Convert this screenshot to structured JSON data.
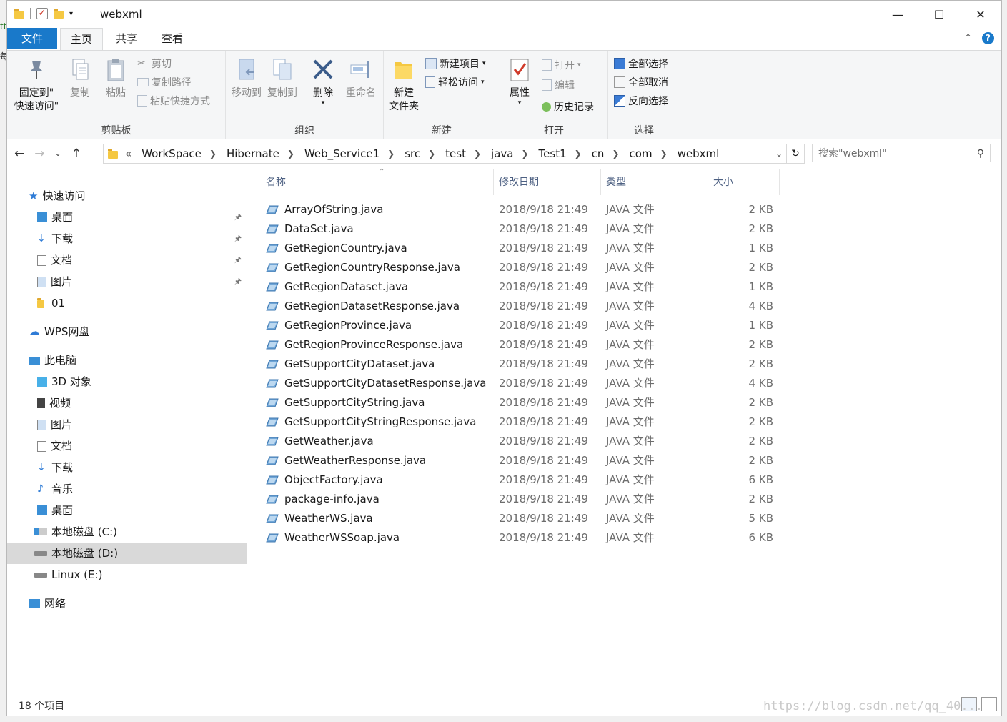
{
  "window": {
    "title": "webxml"
  },
  "tabs": [
    {
      "label": "文件"
    },
    {
      "label": "主页"
    },
    {
      "label": "共享"
    },
    {
      "label": "查看"
    }
  ],
  "ribbon": {
    "clipboard": {
      "label": "剪贴板",
      "pin_line1": "固定到\"",
      "pin_line2": "快速访问\"",
      "copy": "复制",
      "paste": "粘贴",
      "cut": "剪切",
      "copy_path": "复制路径",
      "paste_shortcut": "粘贴快捷方式"
    },
    "organize": {
      "label": "组织",
      "move_to": "移动到",
      "copy_to": "复制到",
      "delete": "删除",
      "rename": "重命名"
    },
    "new": {
      "label": "新建",
      "new_folder_line1": "新建",
      "new_folder_line2": "文件夹",
      "new_item": "新建项目",
      "easy_access": "轻松访问"
    },
    "open": {
      "label": "打开",
      "properties": "属性",
      "open": "打开",
      "edit": "编辑",
      "history": "历史记录"
    },
    "select": {
      "label": "选择",
      "select_all": "全部选择",
      "select_none": "全部取消",
      "invert": "反向选择"
    }
  },
  "address": {
    "crumbs": [
      "WorkSpace",
      "Hibernate",
      "Web_Service1",
      "src",
      "test",
      "java",
      "Test1",
      "cn",
      "com",
      "webxml"
    ]
  },
  "search": {
    "placeholder": "搜索\"webxml\""
  },
  "nav_pane": {
    "quick_access": "快速访问",
    "quick_items": [
      {
        "label": "桌面",
        "pinned": true
      },
      {
        "label": "下载",
        "pinned": true
      },
      {
        "label": "文档",
        "pinned": true
      },
      {
        "label": "图片",
        "pinned": true
      },
      {
        "label": "01",
        "pinned": false
      }
    ],
    "wps": "WPS网盘",
    "this_pc": "此电脑",
    "pc_items": [
      {
        "label": "3D 对象"
      },
      {
        "label": "视频"
      },
      {
        "label": "图片"
      },
      {
        "label": "文档"
      },
      {
        "label": "下载"
      },
      {
        "label": "音乐"
      },
      {
        "label": "桌面"
      },
      {
        "label": "本地磁盘 (C:)"
      },
      {
        "label": "本地磁盘 (D:)"
      },
      {
        "label": "Linux (E:)"
      }
    ],
    "network": "网络"
  },
  "columns": {
    "name": "名称",
    "date": "修改日期",
    "type": "类型",
    "size": "大小"
  },
  "files": [
    {
      "name": "ArrayOfString.java",
      "date": "2018/9/18 21:49",
      "type": "JAVA 文件",
      "size": "2 KB"
    },
    {
      "name": "DataSet.java",
      "date": "2018/9/18 21:49",
      "type": "JAVA 文件",
      "size": "2 KB"
    },
    {
      "name": "GetRegionCountry.java",
      "date": "2018/9/18 21:49",
      "type": "JAVA 文件",
      "size": "1 KB"
    },
    {
      "name": "GetRegionCountryResponse.java",
      "date": "2018/9/18 21:49",
      "type": "JAVA 文件",
      "size": "2 KB"
    },
    {
      "name": "GetRegionDataset.java",
      "date": "2018/9/18 21:49",
      "type": "JAVA 文件",
      "size": "1 KB"
    },
    {
      "name": "GetRegionDatasetResponse.java",
      "date": "2018/9/18 21:49",
      "type": "JAVA 文件",
      "size": "4 KB"
    },
    {
      "name": "GetRegionProvince.java",
      "date": "2018/9/18 21:49",
      "type": "JAVA 文件",
      "size": "1 KB"
    },
    {
      "name": "GetRegionProvinceResponse.java",
      "date": "2018/9/18 21:49",
      "type": "JAVA 文件",
      "size": "2 KB"
    },
    {
      "name": "GetSupportCityDataset.java",
      "date": "2018/9/18 21:49",
      "type": "JAVA 文件",
      "size": "2 KB"
    },
    {
      "name": "GetSupportCityDatasetResponse.java",
      "date": "2018/9/18 21:49",
      "type": "JAVA 文件",
      "size": "4 KB"
    },
    {
      "name": "GetSupportCityString.java",
      "date": "2018/9/18 21:49",
      "type": "JAVA 文件",
      "size": "2 KB"
    },
    {
      "name": "GetSupportCityStringResponse.java",
      "date": "2018/9/18 21:49",
      "type": "JAVA 文件",
      "size": "2 KB"
    },
    {
      "name": "GetWeather.java",
      "date": "2018/9/18 21:49",
      "type": "JAVA 文件",
      "size": "2 KB"
    },
    {
      "name": "GetWeatherResponse.java",
      "date": "2018/9/18 21:49",
      "type": "JAVA 文件",
      "size": "2 KB"
    },
    {
      "name": "ObjectFactory.java",
      "date": "2018/9/18 21:49",
      "type": "JAVA 文件",
      "size": "6 KB"
    },
    {
      "name": "package-info.java",
      "date": "2018/9/18 21:49",
      "type": "JAVA 文件",
      "size": "2 KB"
    },
    {
      "name": "WeatherWS.java",
      "date": "2018/9/18 21:49",
      "type": "JAVA 文件",
      "size": "5 KB"
    },
    {
      "name": "WeatherWSSoap.java",
      "date": "2018/9/18 21:49",
      "type": "JAVA 文件",
      "size": "6 KB"
    }
  ],
  "status": {
    "count": "18 个项目"
  },
  "watermark": "https://blog.csdn.net/qq_40...",
  "colors": {
    "accent": "#1979ca",
    "selected": "#d9d9d9",
    "header_text": "#4d6082"
  }
}
